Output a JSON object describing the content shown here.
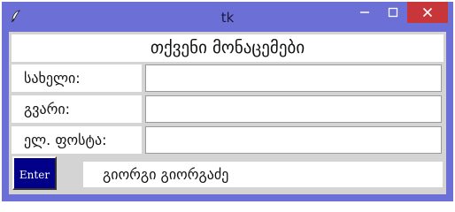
{
  "window": {
    "title": "tk",
    "app_icon": "feather-icon",
    "controls": [
      "minimize-icon",
      "maximize-icon",
      "close-icon"
    ],
    "accent_color": "#6b6fd6",
    "close_color": "#c7373a"
  },
  "form": {
    "heading": "თქვენი მონაცემები",
    "fields": [
      {
        "label": "სახელი:",
        "value": ""
      },
      {
        "label": "გვარი:",
        "value": ""
      },
      {
        "label": "ელ. ფოსტა:",
        "value": ""
      }
    ],
    "enter_button": "Enter",
    "enter_button_color": "#000088",
    "output_text": "გიორგი გიორგაძე"
  }
}
